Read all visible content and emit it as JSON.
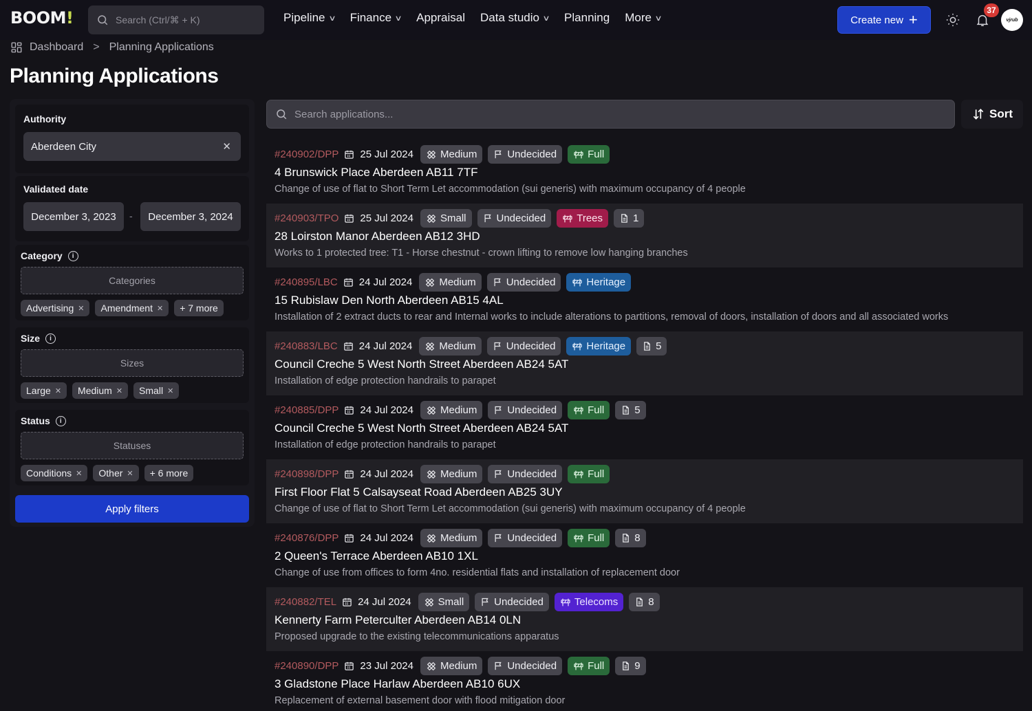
{
  "header": {
    "logo": "BOOM",
    "logo_bang": "!",
    "search_placeholder": "Search (Ctrl/⌘ + K)",
    "nav": [
      {
        "label": "Pipeline",
        "has_dropdown": true
      },
      {
        "label": "Finance",
        "has_dropdown": true
      },
      {
        "label": "Appraisal",
        "has_dropdown": false
      },
      {
        "label": "Data studio",
        "has_dropdown": true
      },
      {
        "label": "Planning",
        "has_dropdown": false
      },
      {
        "label": "More",
        "has_dropdown": true
      }
    ],
    "create_label": "Create new",
    "notification_count": "37",
    "avatar_text": "vjrub"
  },
  "breadcrumb": [
    "Dashboard",
    "Planning Applications"
  ],
  "page_title": "Planning Applications",
  "filters": {
    "authority": {
      "label": "Authority",
      "value": "Aberdeen City"
    },
    "validated_date": {
      "label": "Validated date",
      "from": "December 3, 2023",
      "separator": "-",
      "to": "December 3, 2024"
    },
    "category": {
      "label": "Category",
      "placeholder": "Categories",
      "chips": [
        "Advertising",
        "Amendment"
      ],
      "more": "+ 7 more"
    },
    "size": {
      "label": "Size",
      "placeholder": "Sizes",
      "chips": [
        "Large",
        "Medium",
        "Small"
      ]
    },
    "status": {
      "label": "Status",
      "placeholder": "Statuses",
      "chips": [
        "Conditions",
        "Other"
      ],
      "more": "+ 6 more"
    },
    "apply_label": "Apply filters"
  },
  "main": {
    "search_placeholder": "Search applications...",
    "sort_label": "Sort",
    "colors": {
      "full": "#2a6a3a",
      "trees": "#a01c4a",
      "heritage": "#1e5d9c",
      "telecoms": "#5322d1",
      "ref": "#b35a5e"
    },
    "applications": [
      {
        "ref": "#240902/DPP",
        "date": "25 Jul 2024",
        "size": "Medium",
        "status": "Undecided",
        "type": "Full",
        "type_color": "green",
        "docs": null,
        "address": "4 Brunswick Place Aberdeen AB11 7TF",
        "description": "Change of use of flat to Short Term Let accommodation (sui generis) with maximum occupancy of 4 people"
      },
      {
        "ref": "#240903/TPO",
        "date": "25 Jul 2024",
        "size": "Small",
        "status": "Undecided",
        "type": "Trees",
        "type_color": "red",
        "docs": "1",
        "address": "28 Loirston Manor Aberdeen AB12 3HD",
        "description": "Works to 1 protected tree: T1 - Horse chestnut - crown lifting to remove low hanging branches"
      },
      {
        "ref": "#240895/LBC",
        "date": "24 Jul 2024",
        "size": "Medium",
        "status": "Undecided",
        "type": "Heritage",
        "type_color": "blue",
        "docs": null,
        "address": "15 Rubislaw Den North Aberdeen AB15 4AL",
        "description": "Installation of 2 extract ducts to rear and Internal works to include alterations to partitions, removal of doors, installation of doors and all associated works"
      },
      {
        "ref": "#240883/LBC",
        "date": "24 Jul 2024",
        "size": "Medium",
        "status": "Undecided",
        "type": "Heritage",
        "type_color": "blue",
        "docs": "5",
        "address": "Council Creche 5 West North Street Aberdeen AB24 5AT",
        "description": "Installation of edge protection handrails to parapet"
      },
      {
        "ref": "#240885/DPP",
        "date": "24 Jul 2024",
        "size": "Medium",
        "status": "Undecided",
        "type": "Full",
        "type_color": "green",
        "docs": "5",
        "address": "Council Creche 5 West North Street Aberdeen AB24 5AT",
        "description": "Installation of edge protection handrails to parapet"
      },
      {
        "ref": "#240898/DPP",
        "date": "24 Jul 2024",
        "size": "Medium",
        "status": "Undecided",
        "type": "Full",
        "type_color": "green",
        "docs": null,
        "address": "First Floor Flat 5 Calsayseat Road Aberdeen AB25 3UY",
        "description": "Change of use of flat to Short Term Let accommodation (sui generis) with maximum occupancy of 4 people"
      },
      {
        "ref": "#240876/DPP",
        "date": "24 Jul 2024",
        "size": "Medium",
        "status": "Undecided",
        "type": "Full",
        "type_color": "green",
        "docs": "8",
        "address": "2 Queen's Terrace Aberdeen AB10 1XL",
        "description": "Change of use from offices to form 4no. residential flats and installation of replacement door"
      },
      {
        "ref": "#240882/TEL",
        "date": "24 Jul 2024",
        "size": "Small",
        "status": "Undecided",
        "type": "Telecoms",
        "type_color": "purple",
        "docs": "8",
        "address": "Kennerty Farm Peterculter Aberdeen AB14 0LN",
        "description": "Proposed upgrade to the existing telecommunications apparatus"
      },
      {
        "ref": "#240890/DPP",
        "date": "23 Jul 2024",
        "size": "Medium",
        "status": "Undecided",
        "type": "Full",
        "type_color": "green",
        "docs": "9",
        "address": "3 Gladstone Place Harlaw Aberdeen AB10 6UX",
        "description": "Replacement of external basement door with flood mitigation door"
      }
    ]
  }
}
